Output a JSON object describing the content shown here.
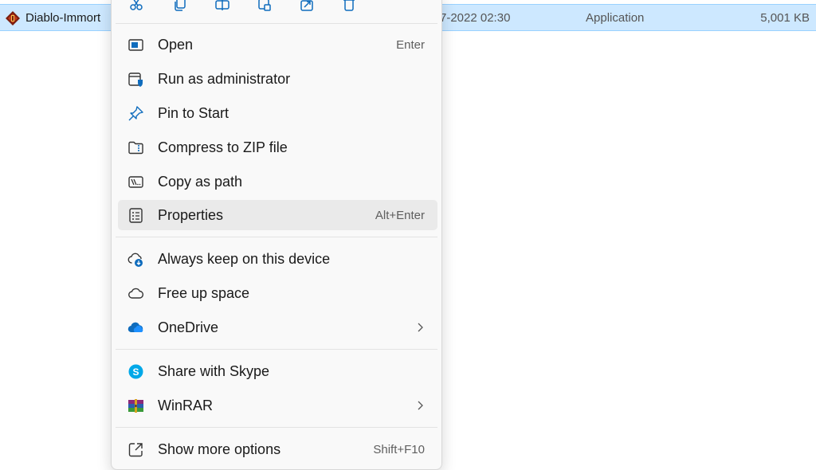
{
  "file": {
    "name": "Diablo-Immort",
    "date": "7-2022 02:30",
    "type": "Application",
    "size": "5,001 KB",
    "icon": "diablo-app-icon"
  },
  "quick_actions": [
    {
      "name": "cut",
      "icon": "scissors-icon"
    },
    {
      "name": "copy",
      "icon": "copy-icon"
    },
    {
      "name": "rename",
      "icon": "rename-icon"
    },
    {
      "name": "paste",
      "icon": "paste-icon"
    },
    {
      "name": "share",
      "icon": "share-icon"
    },
    {
      "name": "delete",
      "icon": "trash-icon"
    }
  ],
  "menu": {
    "open": {
      "label": "Open",
      "shortcut": "Enter",
      "icon": "open-window-icon"
    },
    "run_admin": {
      "label": "Run as administrator",
      "icon": "admin-shield-icon"
    },
    "pin_start": {
      "label": "Pin to Start",
      "icon": "pin-icon"
    },
    "compress_zip": {
      "label": "Compress to ZIP file",
      "icon": "zip-folder-icon"
    },
    "copy_path": {
      "label": "Copy as path",
      "icon": "copy-path-icon"
    },
    "properties": {
      "label": "Properties",
      "shortcut": "Alt+Enter",
      "icon": "properties-icon"
    },
    "keep_on_device": {
      "label": "Always keep on this device",
      "icon": "cloud-download-icon"
    },
    "free_up_space": {
      "label": "Free up space",
      "icon": "cloud-icon"
    },
    "onedrive": {
      "label": "OneDrive",
      "icon": "onedrive-icon"
    },
    "share_skype": {
      "label": "Share with Skype",
      "icon": "skype-icon"
    },
    "winrar": {
      "label": "WinRAR",
      "icon": "winrar-icon"
    },
    "show_more": {
      "label": "Show more options",
      "shortcut": "Shift+F10",
      "icon": "show-more-icon"
    }
  },
  "colors": {
    "accent": "#0067c0",
    "selection": "#cde8ff",
    "menu_bg": "#f9f9f9",
    "hover": "#eaeaea"
  }
}
